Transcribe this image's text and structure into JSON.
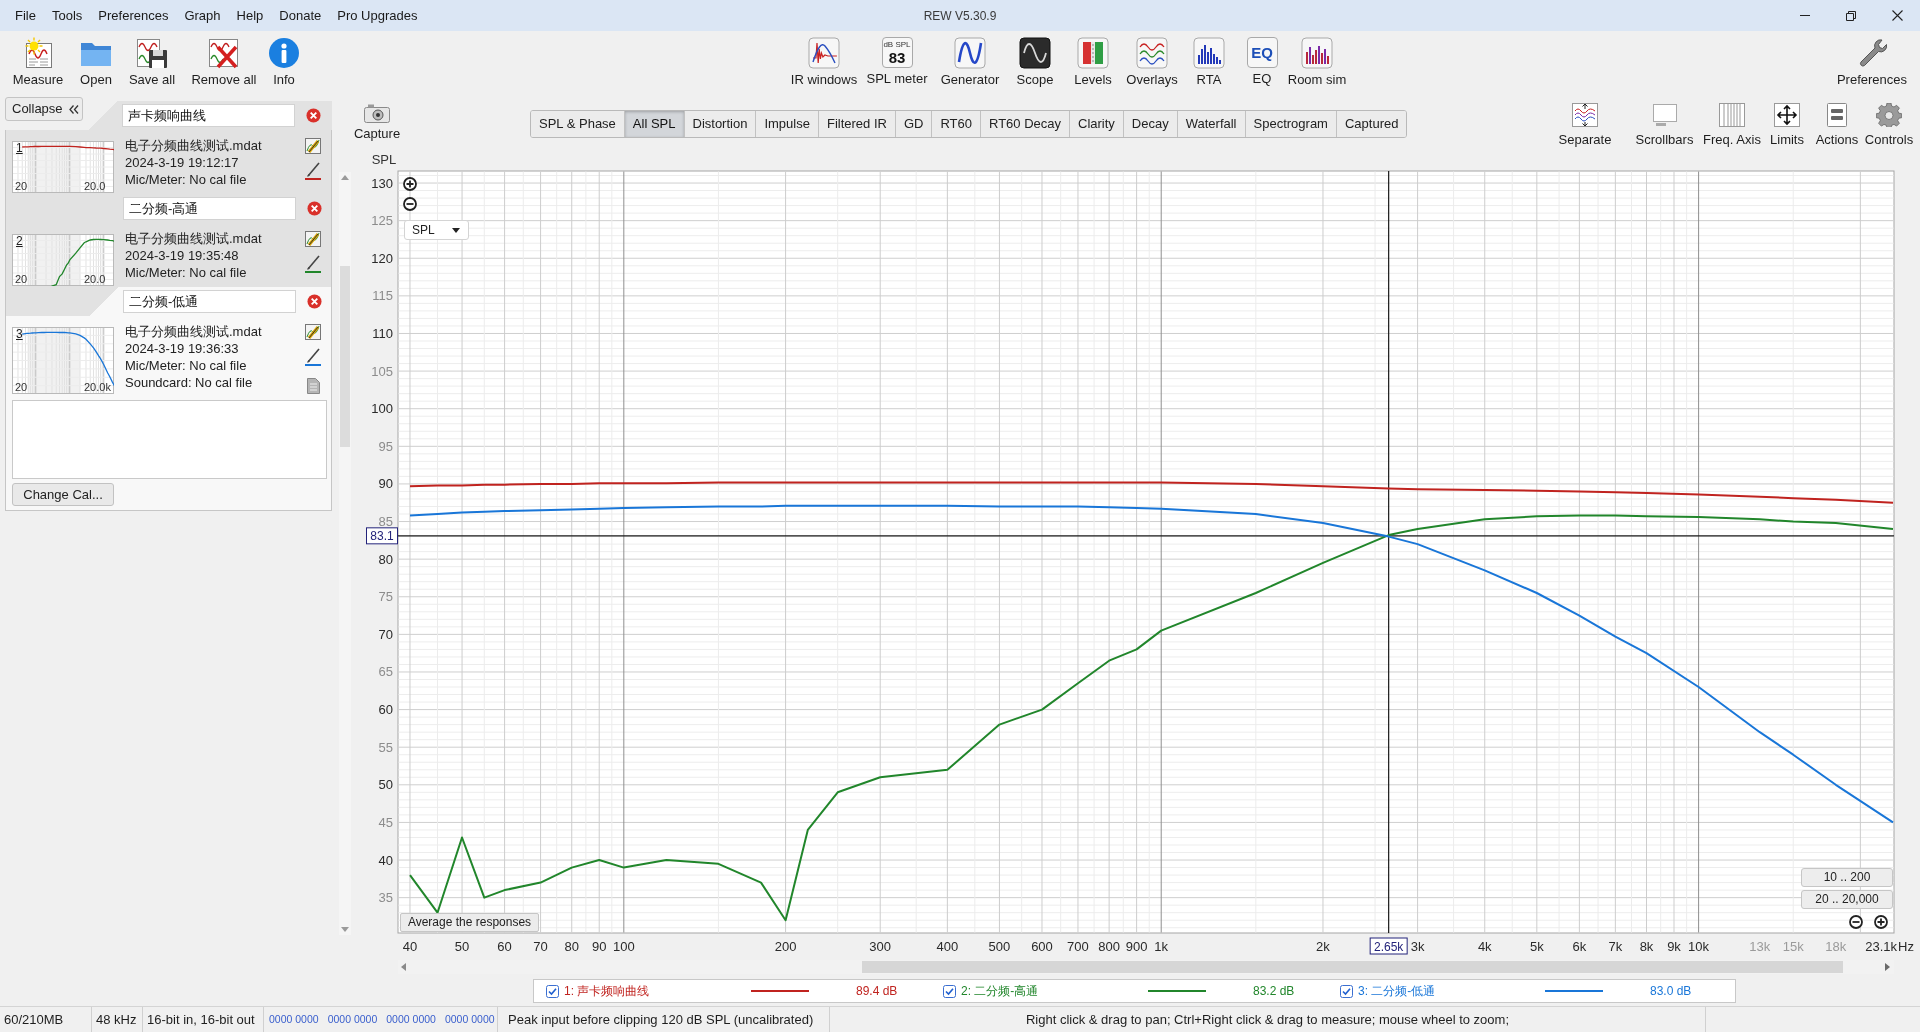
{
  "window": {
    "title": "REW V5.30.9"
  },
  "menu": [
    "File",
    "Tools",
    "Preferences",
    "Graph",
    "Help",
    "Donate",
    "Pro Upgrades"
  ],
  "toolbar": {
    "left": [
      {
        "kind": "measure",
        "label": "Measure"
      },
      {
        "kind": "open",
        "label": "Open"
      },
      {
        "kind": "save",
        "label": "Save all"
      },
      {
        "kind": "remove",
        "label": "Remove all"
      },
      {
        "kind": "info",
        "label": "Info"
      }
    ],
    "center": [
      {
        "kind": "ir",
        "label": "IR windows"
      },
      {
        "kind": "spl",
        "label": "SPL meter",
        "icon_text": [
          "dB SPL",
          "83"
        ]
      },
      {
        "kind": "generator",
        "label": "Generator"
      },
      {
        "kind": "scope",
        "label": "Scope"
      },
      {
        "kind": "levels",
        "label": "Levels"
      },
      {
        "kind": "overlays",
        "label": "Overlays"
      },
      {
        "kind": "rta",
        "label": "RTA"
      },
      {
        "kind": "eq",
        "label": "EQ",
        "icon_text": [
          "EQ"
        ]
      },
      {
        "kind": "roomsim",
        "label": "Room sim"
      }
    ],
    "right": [
      {
        "kind": "preferences",
        "label": "Preferences"
      }
    ]
  },
  "sidebar": {
    "collapse_button": "Collapse",
    "measurements": [
      {
        "name": "声卡频响曲线",
        "number": "1",
        "axis_min": "20",
        "axis_max": "20.0",
        "lines": [
          "电子分频曲线测试.mdat",
          "2024-3-19 19:12:17",
          "Mic/Meter: No cal file"
        ],
        "color": "#c0231f",
        "selected": false,
        "file_icon": false
      },
      {
        "name": "二分频-高通",
        "number": "2",
        "axis_min": "20",
        "axis_max": "20.0",
        "lines": [
          "电子分频曲线测试.mdat",
          "2024-3-19 19:35:48",
          "Mic/Meter: No cal file"
        ],
        "color": "#21862b",
        "selected": false,
        "file_icon": false
      },
      {
        "name": "二分频-低通",
        "number": "3",
        "axis_min": "20",
        "axis_max": "20.0k",
        "lines": [
          "电子分频曲线测试.mdat",
          "2024-3-19 19:36:33",
          "Mic/Meter: No cal file",
          "Soundcard: No cal file"
        ],
        "color": "#1976d8",
        "selected": true,
        "file_icon": true
      }
    ],
    "change_cal_button": "Change Cal..."
  },
  "graph": {
    "capture_button": "Capture",
    "tabs": [
      {
        "label": "SPL & Phase",
        "selected": false
      },
      {
        "label": "All SPL",
        "selected": true
      },
      {
        "label": "Distortion",
        "selected": false
      },
      {
        "label": "Impulse",
        "selected": false
      },
      {
        "label": "Filtered IR",
        "selected": false
      },
      {
        "label": "GD",
        "selected": false
      },
      {
        "label": "RT60",
        "selected": false
      },
      {
        "label": "RT60 Decay",
        "selected": false
      },
      {
        "label": "Clarity",
        "selected": false
      },
      {
        "label": "Decay",
        "selected": false
      },
      {
        "label": "Waterfall",
        "selected": false
      },
      {
        "label": "Spectrogram",
        "selected": false
      },
      {
        "label": "Captured",
        "selected": false
      }
    ],
    "view_buttons": [
      {
        "kind": "separate",
        "label": "Separate"
      },
      {
        "kind": "scrollbars",
        "label": "Scrollbars"
      },
      {
        "kind": "freq_axis",
        "label": "Freq. Axis"
      },
      {
        "kind": "limits",
        "label": "Limits"
      },
      {
        "kind": "actions",
        "label": "Actions"
      },
      {
        "kind": "controls",
        "label": "Controls"
      }
    ],
    "trace_select": "SPL",
    "average_button": "Average the responses",
    "range_buttons": [
      "10 .. 200",
      "20 .. 20,000"
    ],
    "chart_data": {
      "type": "line",
      "xlabel": "Hz",
      "ylabel": "SPL",
      "log": "x",
      "grid": true,
      "x": [
        40,
        45,
        50,
        55,
        60,
        70,
        80,
        90,
        100,
        120,
        150,
        180,
        200,
        220,
        250,
        300,
        400,
        500,
        600,
        700,
        800,
        900,
        1000,
        1500,
        2000,
        2650,
        3000,
        4000,
        5000,
        6000,
        7000,
        8000,
        10000,
        13000,
        15000,
        18000,
        23000
      ],
      "series": [
        {
          "name": "1: 声卡频响曲线",
          "color": "#c0231f",
          "values": [
            89.7,
            89.8,
            89.8,
            89.9,
            89.9,
            90.0,
            90.0,
            90.1,
            90.1,
            90.1,
            90.2,
            90.2,
            90.2,
            90.2,
            90.2,
            90.2,
            90.2,
            90.2,
            90.2,
            90.2,
            90.2,
            90.2,
            90.2,
            90.0,
            89.7,
            89.4,
            89.3,
            89.2,
            89.1,
            89.0,
            88.9,
            88.8,
            88.6,
            88.3,
            88.1,
            87.9,
            87.5
          ]
        },
        {
          "name": "2: 二分频-高通",
          "color": "#21862b",
          "values": [
            38,
            33,
            43,
            35,
            36,
            37,
            39,
            40,
            39,
            40,
            39.5,
            37,
            32,
            44,
            49,
            51,
            52,
            58,
            60,
            63.5,
            66.5,
            68,
            70.5,
            75.5,
            79.5,
            83.2,
            84,
            85.3,
            85.7,
            85.8,
            85.8,
            85.7,
            85.6,
            85.3,
            85,
            84.8,
            84
          ]
        },
        {
          "name": "3: 二分频-低通",
          "color": "#1976d8",
          "values": [
            85.8,
            86.0,
            86.2,
            86.3,
            86.4,
            86.5,
            86.6,
            86.7,
            86.8,
            86.9,
            87.0,
            87.0,
            87.1,
            87.1,
            87.1,
            87.1,
            87.1,
            87.0,
            87.0,
            87.0,
            86.9,
            86.8,
            86.7,
            86.0,
            84.8,
            83.0,
            82.0,
            78.5,
            75.5,
            72.5,
            69.7,
            67.5,
            63,
            57,
            54,
            50,
            45
          ]
        }
      ],
      "xlim": [
        38,
        23100
      ],
      "ylim": [
        30.3,
        131.6
      ],
      "xticks": [
        {
          "value": 40,
          "label": "40"
        },
        {
          "value": 50,
          "label": "50"
        },
        {
          "value": 60,
          "label": "60"
        },
        {
          "value": 70,
          "label": "70"
        },
        {
          "value": 80,
          "label": "80"
        },
        {
          "value": 90,
          "label": "90"
        },
        {
          "value": 100,
          "label": "100"
        },
        {
          "value": 200,
          "label": "200"
        },
        {
          "value": 300,
          "label": "300"
        },
        {
          "value": 400,
          "label": "400"
        },
        {
          "value": 500,
          "label": "500"
        },
        {
          "value": 600,
          "label": "600"
        },
        {
          "value": 700,
          "label": "700"
        },
        {
          "value": 800,
          "label": "800"
        },
        {
          "value": 900,
          "label": "900"
        },
        {
          "value": 1000,
          "label": "1k"
        },
        {
          "value": 2000,
          "label": "2k"
        },
        {
          "value": 3000,
          "label": "3k"
        },
        {
          "value": 4000,
          "label": "4k"
        },
        {
          "value": 5000,
          "label": "5k"
        },
        {
          "value": 6000,
          "label": "6k"
        },
        {
          "value": 7000,
          "label": "7k"
        },
        {
          "value": 8000,
          "label": "8k"
        },
        {
          "value": 9000,
          "label": "9k"
        },
        {
          "value": 10000,
          "label": "10k"
        },
        {
          "value": 13000,
          "label": "13k"
        },
        {
          "value": 15000,
          "label": "15k"
        },
        {
          "value": 18000,
          "label": "18k"
        },
        {
          "value": 23100,
          "label": "23.1k"
        }
      ],
      "yticks": [
        35,
        40,
        45,
        50,
        55,
        60,
        65,
        70,
        75,
        80,
        85,
        90,
        95,
        100,
        105,
        110,
        115,
        120,
        125,
        130
      ],
      "ref_lines": [
        {
          "axis": "x",
          "value": 2650,
          "label": "2.65k"
        },
        {
          "axis": "y",
          "value": 83.1,
          "label": "83.1"
        }
      ]
    },
    "legend": [
      {
        "checked": true,
        "reading": "89.4 dB"
      },
      {
        "checked": true,
        "reading": "83.2 dB"
      },
      {
        "checked": true,
        "reading": "83.0 dB"
      }
    ]
  },
  "status_bar": {
    "memory": "60/210MB",
    "sample_rate": "48 kHz",
    "bit_depth": "16-bit in, 16-bit out",
    "input_levels": [
      "0000 0000",
      "0000 0000",
      "0000 0000",
      "0000 0000"
    ],
    "peak_input": "Peak input before clipping 120 dB SPL (uncalibrated)",
    "hint": "Right click & drag to pan; Ctrl+Right click & drag to measure; mouse wheel to zoom;"
  }
}
